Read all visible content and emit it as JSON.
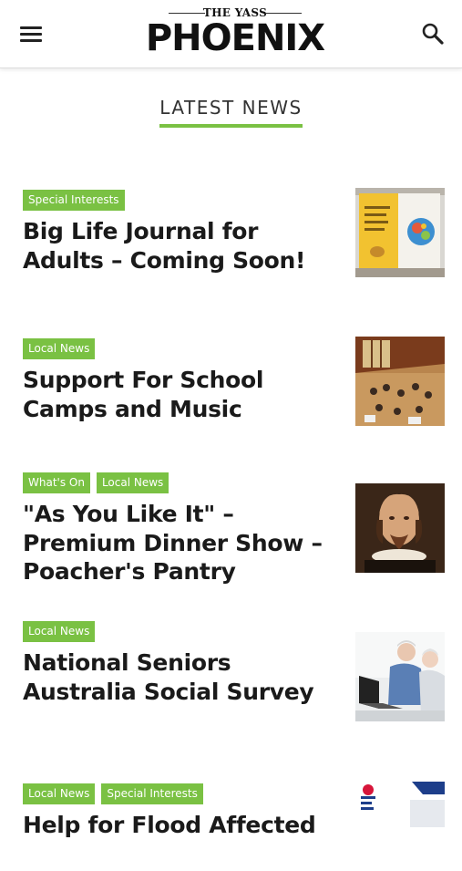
{
  "header": {
    "logo_top": "THE YASS",
    "logo_main": "PHOENIX",
    "menu_icon": "hamburger-menu-icon",
    "search_icon": "search-icon"
  },
  "section": {
    "title": "LATEST NEWS"
  },
  "articles": [
    {
      "tags": [
        "Special Interests"
      ],
      "title": "Big Life Journal for Adults – Coming Soon!",
      "thumbnail": "journal-book-thumbnail"
    },
    {
      "tags": [
        "Local News"
      ],
      "title": "Support For School Camps and Music",
      "thumbnail": "school-hall-thumbnail"
    },
    {
      "tags": [
        "What's On",
        "Local News"
      ],
      "title": "\"As You Like It\" – Premium Dinner Show – Poacher's Pantry",
      "thumbnail": "shakespeare-portrait-thumbnail"
    },
    {
      "tags": [
        "Local News"
      ],
      "title": "National Seniors Australia Social Survey",
      "thumbnail": "seniors-laptop-thumbnail"
    },
    {
      "tags": [
        "Local News",
        "Special Interests"
      ],
      "title": "Help for Flood Affected",
      "thumbnail": "nsw-flyer-thumbnail"
    }
  ],
  "colors": {
    "accent": "#7ac143",
    "text": "#1a1a1a"
  }
}
